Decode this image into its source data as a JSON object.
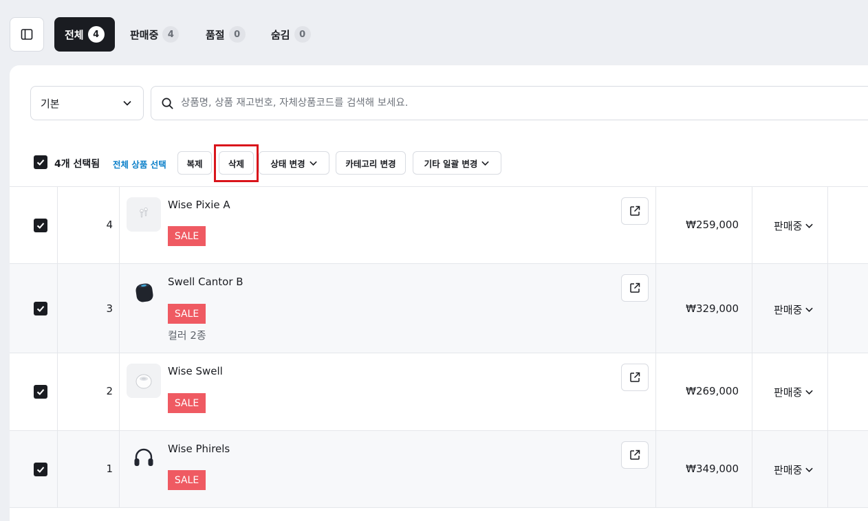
{
  "tabs": [
    {
      "label": "전체",
      "count": "4"
    },
    {
      "label": "판매중",
      "count": "4"
    },
    {
      "label": "품절",
      "count": "0"
    },
    {
      "label": "숨김",
      "count": "0"
    }
  ],
  "filter": {
    "select_value": "기본",
    "search_placeholder": "상품명, 상품 재고번호, 자체상품코드를 검색해 보세요."
  },
  "bulk": {
    "selected_text": "4개 선택됨",
    "select_all_link": "전체 상품 선택",
    "buttons": {
      "duplicate": "복제",
      "delete": "삭제",
      "status_change": "상태 변경",
      "category_change": "카테고리 변경",
      "other_bulk_change": "기타 일괄 변경"
    }
  },
  "products": [
    {
      "index": "4",
      "name": "Wise Pixie A",
      "badge": "SALE",
      "variant": "",
      "price": "₩259,000",
      "status": "판매중",
      "icon": "earbuds-icon"
    },
    {
      "index": "3",
      "name": "Swell Cantor B",
      "badge": "SALE",
      "variant": "컬러 2종",
      "price": "₩329,000",
      "status": "판매중",
      "icon": "smart-speaker-icon"
    },
    {
      "index": "2",
      "name": "Wise Swell",
      "badge": "SALE",
      "variant": "",
      "price": "₩269,000",
      "status": "판매중",
      "icon": "mini-speaker-icon"
    },
    {
      "index": "1",
      "name": "Wise Phirels",
      "badge": "SALE",
      "variant": "",
      "price": "₩349,000",
      "status": "판매중",
      "icon": "headphones-icon"
    }
  ],
  "colors": {
    "accent_dark": "#1a1c21",
    "sale_badge": "#ef5a62",
    "link_blue": "#0a7fc9",
    "highlight_red": "#d9141b"
  }
}
